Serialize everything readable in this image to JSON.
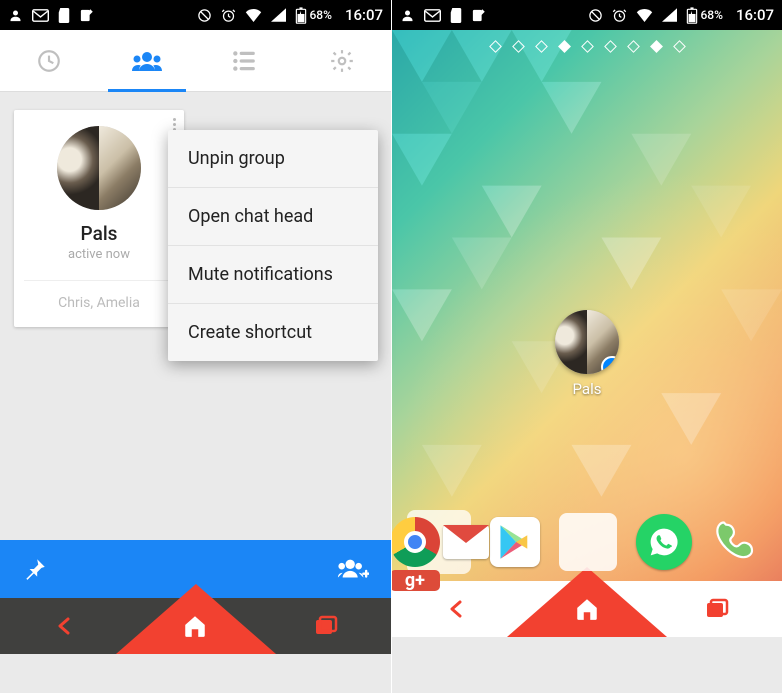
{
  "status": {
    "battery": "68%",
    "time": "16:07"
  },
  "messenger": {
    "group_name": "Pals",
    "group_status": "active now",
    "members": "Chris, Amelia",
    "menu": {
      "unpin": "Unpin group",
      "chat_head": "Open chat head",
      "mute": "Mute notifications",
      "shortcut": "Create shortcut"
    }
  },
  "home": {
    "shortcut_label": "Pals"
  }
}
